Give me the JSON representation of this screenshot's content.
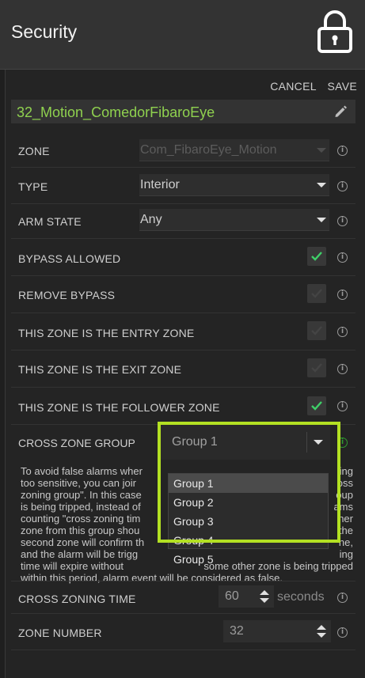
{
  "header": {
    "title": "Security",
    "lock_icon": "lock-icon"
  },
  "actions": {
    "cancel": "CANCEL",
    "save": "SAVE"
  },
  "device": {
    "name": "32_Motion_ComedorFibaroEye",
    "edit_icon": "pencil-icon"
  },
  "fields": {
    "zone": {
      "label": "ZONE",
      "value": "Com_FibaroEye_Motion",
      "disabled": true
    },
    "type": {
      "label": "TYPE",
      "value": "Interior"
    },
    "arm_state": {
      "label": "ARM STATE",
      "value": "Any"
    },
    "bypass_allowed": {
      "label": "BYPASS ALLOWED",
      "checked": true
    },
    "remove_bypass": {
      "label": "REMOVE BYPASS",
      "checked": false
    },
    "entry_zone": {
      "label": "THIS ZONE IS THE ENTRY ZONE",
      "checked": false
    },
    "exit_zone": {
      "label": "THIS ZONE IS THE EXIT ZONE",
      "checked": false
    },
    "follower_zone": {
      "label": "THIS ZONE IS THE FOLLOWER ZONE",
      "checked": true
    },
    "cross_zone_group": {
      "label": "CROSS ZONE GROUP",
      "value": "Group 1"
    },
    "cross_zoning_time": {
      "label": "CROSS ZONING TIME",
      "value": "60",
      "unit": "seconds"
    },
    "zone_number": {
      "label": "ZONE NUMBER",
      "value": "32"
    }
  },
  "description": {
    "lines": [
      "To avoid false alarms wher",
      "ing",
      "too sensitive, you can joir",
      "oss",
      "zoning group\". In this case",
      "oup",
      "is being tripped, instead of",
      "ams",
      "counting \"cross zoning tim",
      "her",
      "zone from this group shou",
      "the",
      "second zone will confirm th",
      "ne,",
      "and the alarm will be trigg",
      "ing",
      "time will expire without",
      "some other zone is being tripped",
      "within this period, alarm event will be considered as false."
    ]
  },
  "cross_zone_options": [
    "Group 1",
    "Group 2",
    "Group 3",
    "Group 4",
    "Group 5"
  ],
  "colors": {
    "accent_green": "#8fd14f",
    "highlight_box": "#b3e023",
    "check_green": "#3fcf68"
  }
}
